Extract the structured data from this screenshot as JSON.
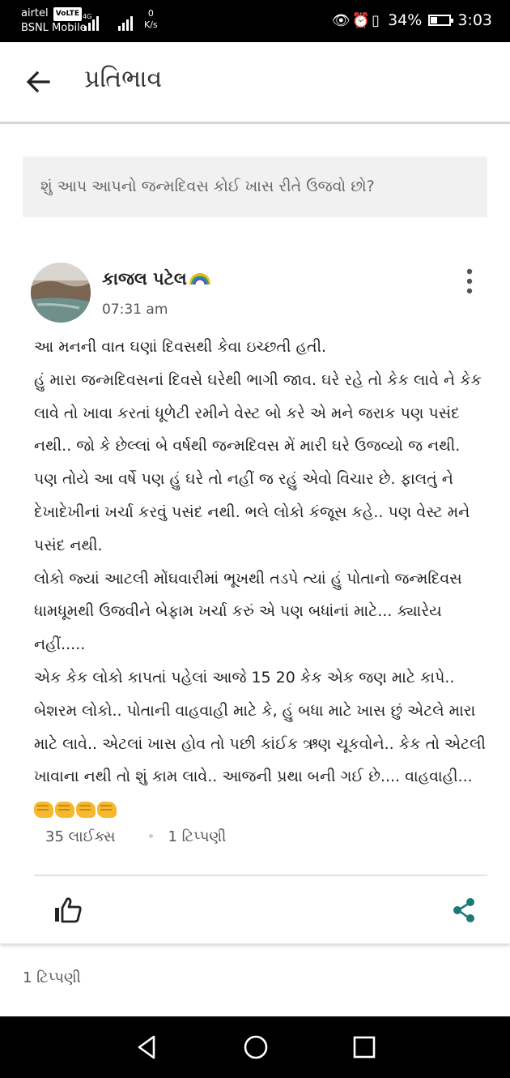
{
  "status_bar": {
    "carrier1": "airtel",
    "volte": "VoLTE",
    "carrier2": "BSNL Mobile",
    "net_speed_value": "0",
    "net_speed_unit": "K/s",
    "battery": "34%",
    "battery_level": 0.34,
    "time": "3:03"
  },
  "app_bar": {
    "title": "પ્રતિભાવ",
    "back_icon": "arrow-left-icon"
  },
  "question": {
    "text": "શું આપ આપનો જન્મદિવસ કોઈ ખાસ રીતે ઉજવો છો?"
  },
  "post": {
    "author": "કાજલ પટેલ",
    "time": "07:31 am",
    "paragraphs": [
      "આ મનની વાત ઘણાં દિવસથી કેવા ઇચ્છતી હતી.",
      "હું મારા જન્મદિવસનાં દિવસે ઘરેથી ભાગી જાવ. ઘરે રહે તો કેક લાવે ને કેક લાવે તો ખાવા કરતાં ધૂળેટી રમીને વેસ્ટ બો કરે એ મને જરાક પણ પસંદ નથી.. જો કે છેલ્લાં બે વર્ષથી જન્મદિવસ મેં મારી ઘરે ઉજવ્યો જ નથી. પણ તોયે આ વર્ષે પણ હું ઘરે તો નહીં જ રહું એવો વિચાર છે. ફાલતું ને દેખાદેખીનાં ખર્ચા કરવું પસંદ નથી. ભલે લોકો કંજૂસ કહે.. પણ વેસ્ટ મને પસંદ નથી.",
      "લોકો જ્યાં આટલી મોંઘવારીમાં ભૂખથી તડપે ત્યાં હું પોતાનો જન્મદિવસ ધામધૂમથી ઉજવીને બેફામ ખર્ચા કરું એ પણ બધાંનાં માટે... ક્યારેય નહીં.....",
      "એક કેક લોકો કાપતાં પહેલાં આજે 15 20 કેક એક જણ માટે કાપે.. બેશરમ લોકો.. પોતાની વાહવાહી માટે કે, હું બધા માટે ખાસ છું એટલે મારા માટે લાવે.. એટલાં ખાસ હોવ તો પછી કાંઈક ઋણ ચૂકવોને.. કેક તો એટલી ખાવાના નથી તો શું કામ લાવે.. આજની પ્રથા બની ગઈ છે.... વાહવાહી..."
    ],
    "likes": "35 લાઈક્સ",
    "comments": "1 ટિપ્પણી",
    "emoji_icon": "oncoming-fist-icon"
  },
  "comments_section": {
    "count_label": "1 ટિપ્પણી"
  },
  "colors": {
    "accent": "#1c7a76",
    "status_bar": "#000000",
    "question_bg": "#f1f1f1"
  }
}
